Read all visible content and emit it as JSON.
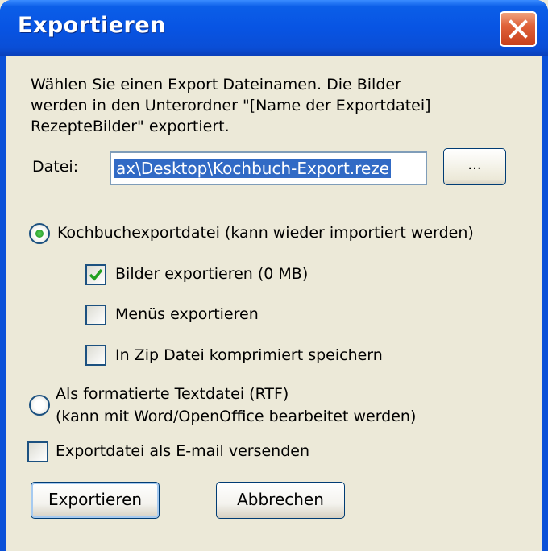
{
  "window": {
    "title": "Exportieren"
  },
  "intro_text": "Wählen Sie einen Export Dateinamen.  Die Bilder\nwerden in den Unterordner \"[Name der Exportdatei]\nRezepteBilder\" exportiert.",
  "file": {
    "label": "Datei:",
    "value": "ax\\Desktop\\Kochbuch-Export.reze",
    "browse_label": "..."
  },
  "options": {
    "cookbook_export": {
      "label": "Kochbuchexportdatei (kann wieder importiert werden)",
      "selected": true
    },
    "export_images": {
      "label": "Bilder exportieren (0 MB)",
      "checked": true
    },
    "export_menus": {
      "label": "Menüs exportieren",
      "checked": false
    },
    "zip_save": {
      "label": "In Zip Datei komprimiert speichern",
      "checked": false
    },
    "rtf_export": {
      "label_line1": "Als formatierte Textdatei (RTF)",
      "label_line2": "(kann mit Word/OpenOffice bearbeitet werden)",
      "selected": false
    },
    "send_email": {
      "label": "Exportdatei als E-mail versenden",
      "checked": false
    }
  },
  "buttons": {
    "export_label": "Exportieren",
    "cancel_label": "Abbrechen"
  },
  "colors": {
    "titlebar": "#0a54e3",
    "close": "#e0623a",
    "face": "#ece9d8",
    "selection": "#316ac5",
    "check": "#21a121"
  }
}
